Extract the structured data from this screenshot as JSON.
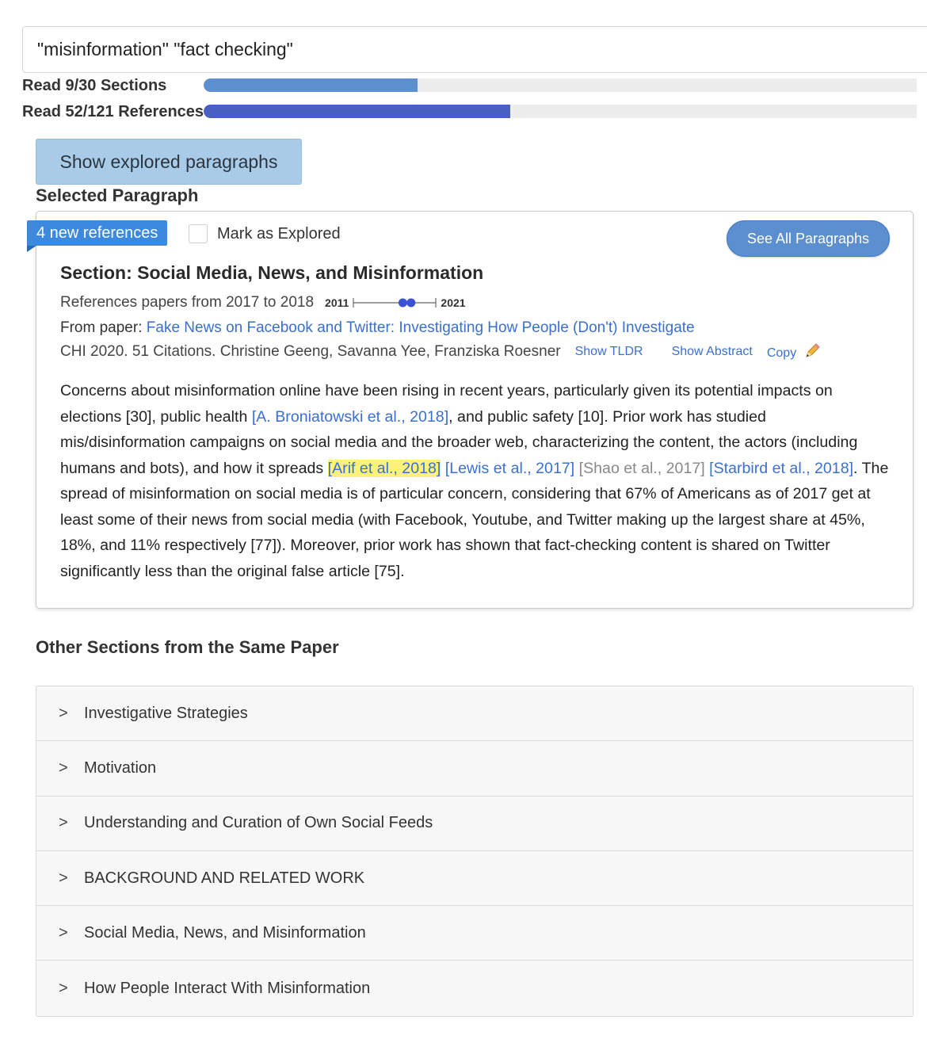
{
  "search": {
    "value": "\"misinformation\" \"fact checking\""
  },
  "progress": {
    "sections": {
      "label": "Read 9/30 Sections",
      "read": 9,
      "total": 30,
      "color": "#5b8fcf"
    },
    "references": {
      "label": "Read 52/121 References",
      "read": 52,
      "total": 121,
      "color": "#4a5fc2"
    }
  },
  "explored_button": {
    "label": "Show explored paragraphs"
  },
  "selected_heading": "Selected Paragraph",
  "card": {
    "badge": "4 new references",
    "mark_explored": "Mark as Explored",
    "see_all": "See All Paragraphs",
    "title": "Section: Social Media, News, and Misinformation",
    "ref_range": "References papers from 2017 to 2018",
    "timeline": {
      "start_label": "2011",
      "end_label": "2021",
      "range_start": 2017,
      "range_end": 2018
    },
    "from_label": "From paper: ",
    "paper_title": "Fake News on Facebook and Twitter: Investigating How People (Don't) Investigate",
    "meta": "CHI 2020. 51 Citations. Christine Geeng, Savanna Yee, Franziska Roesner",
    "show_tldr": "Show TLDR",
    "show_abstract": "Show Abstract",
    "copy": "Copy",
    "paragraph": {
      "p1": "Concerns about misinformation online have been rising in recent years, particularly given its potential impacts on elections [30], public health ",
      "c1": "[A. Broniatowski et al., 2018]",
      "p2": ", and public safety [10]. Prior work has studied mis/disinformation campaigns on social media and the broader web, characterizing the content, the actors (including humans and bots), and how it spreads ",
      "c2": "[Arif et al., 2018]",
      "c3": "[Lewis et al., 2017]",
      "c4": "[Shao et al., 2017]",
      "c5": "[Starbird et al., 2018]",
      "p3": ". The spread of misinformation on social media is of particular concern, considering that 67% of Americans as of 2017 get at least some of their news from social media (with Facebook, Youtube, and Twitter making up the largest share at 45%, 18%, and 11% respectively [77]). Moreover, prior work has shown that fact-checking content is shared on Twitter significantly less than the original false article [75]."
    }
  },
  "other_heading": "Other Sections from the Same Paper",
  "sections": [
    "Investigative Strategies",
    "Motivation",
    "Understanding and Curation of Own Social Feeds",
    "BACKGROUND AND RELATED WORK",
    "Social Media, News, and Misinformation",
    "How People Interact With Misinformation"
  ],
  "icons": {
    "chevron": "chevron-right-icon",
    "pencil": "pencil-icon"
  }
}
